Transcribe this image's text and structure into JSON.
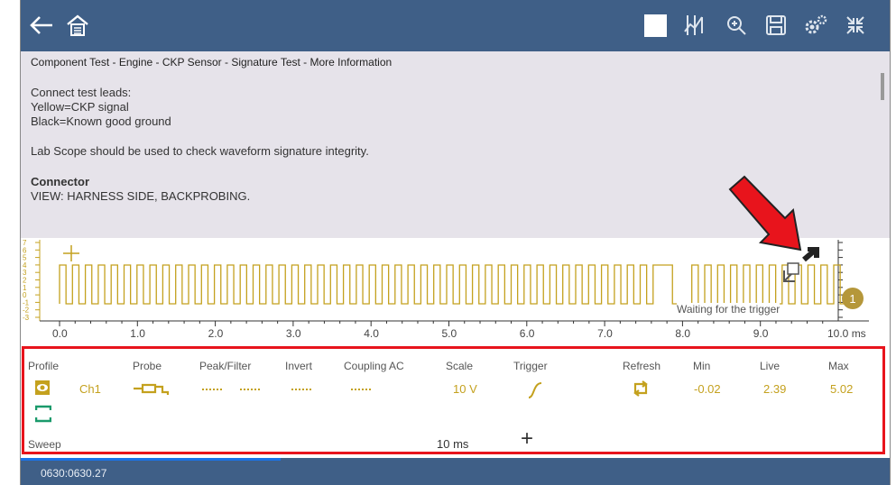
{
  "breadcrumb": "Component Test - Engine - CKP Sensor - Signature Test - More Information",
  "info": {
    "l1": "Connect test leads:",
    "l2": "Yellow=CKP signal",
    "l3": "Black=Known good ground",
    "l4": "Lab Scope should be used to check waveform signature integrity.",
    "l5": "Connector",
    "l6": "VIEW: HARNESS SIDE, BACKPROBING."
  },
  "scope": {
    "x_ticks": [
      "0.0",
      "1.0",
      "2.0",
      "3.0",
      "4.0",
      "5.0",
      "6.0",
      "7.0",
      "8.0",
      "9.0",
      "10.0 ms"
    ],
    "y_ticks": [
      "7",
      "6",
      "5",
      "4",
      "3",
      "2",
      "1",
      "0",
      "-1",
      "-2",
      "-3"
    ],
    "status": "Waiting for the trigger",
    "channel_badge": "1"
  },
  "params": {
    "headers": {
      "profile": "Profile",
      "probe": "Probe",
      "peak": "Peak/Filter",
      "invert": "Invert",
      "coupling": "Coupling AC",
      "scale": "Scale",
      "trigger": "Trigger",
      "refresh": "Refresh",
      "min": "Min",
      "live": "Live",
      "max": "Max"
    },
    "channel": "Ch1",
    "scale": "10 V",
    "min": "-0.02",
    "live": "2.39",
    "max": "5.02",
    "sweep_label": "Sweep",
    "sweep_value": "10 ms",
    "add": "+"
  },
  "status_bar": "0630:0630.27"
}
